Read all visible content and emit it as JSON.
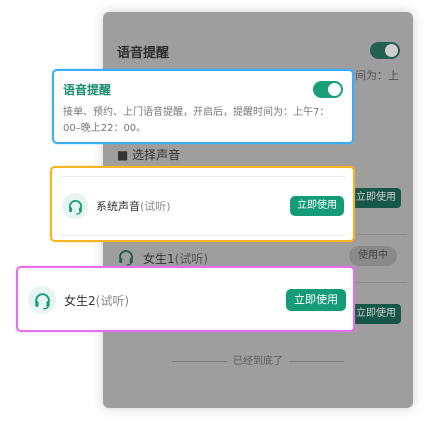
{
  "background_panel": {
    "title": "语音提醒",
    "truncated_text": "间为：上",
    "section_label": "■ 选择声音",
    "row_button_label": "立即使用",
    "current_item": {
      "name": "女生1",
      "sub": "(试听)"
    },
    "current_badge": "使用中",
    "end_text": "已经到底了"
  },
  "voice_card": {
    "title": "语音提醒",
    "toggle_on": true,
    "description": "接单、预约、上门语音提醒，开启后，提醒时间为：上午7：00–晚上22：00。"
  },
  "system_card": {
    "name": "系统声音",
    "sub": "(试听)",
    "button": "立即使用"
  },
  "female2_card": {
    "name": "女生2",
    "sub": "(试听)",
    "button": "立即使用"
  },
  "colors": {
    "accent": "#159b77",
    "border_blue": "#3aaefc",
    "border_yellow": "#f5b523",
    "border_pink": "#e66ef0"
  },
  "icons": [
    "headset-icon"
  ]
}
